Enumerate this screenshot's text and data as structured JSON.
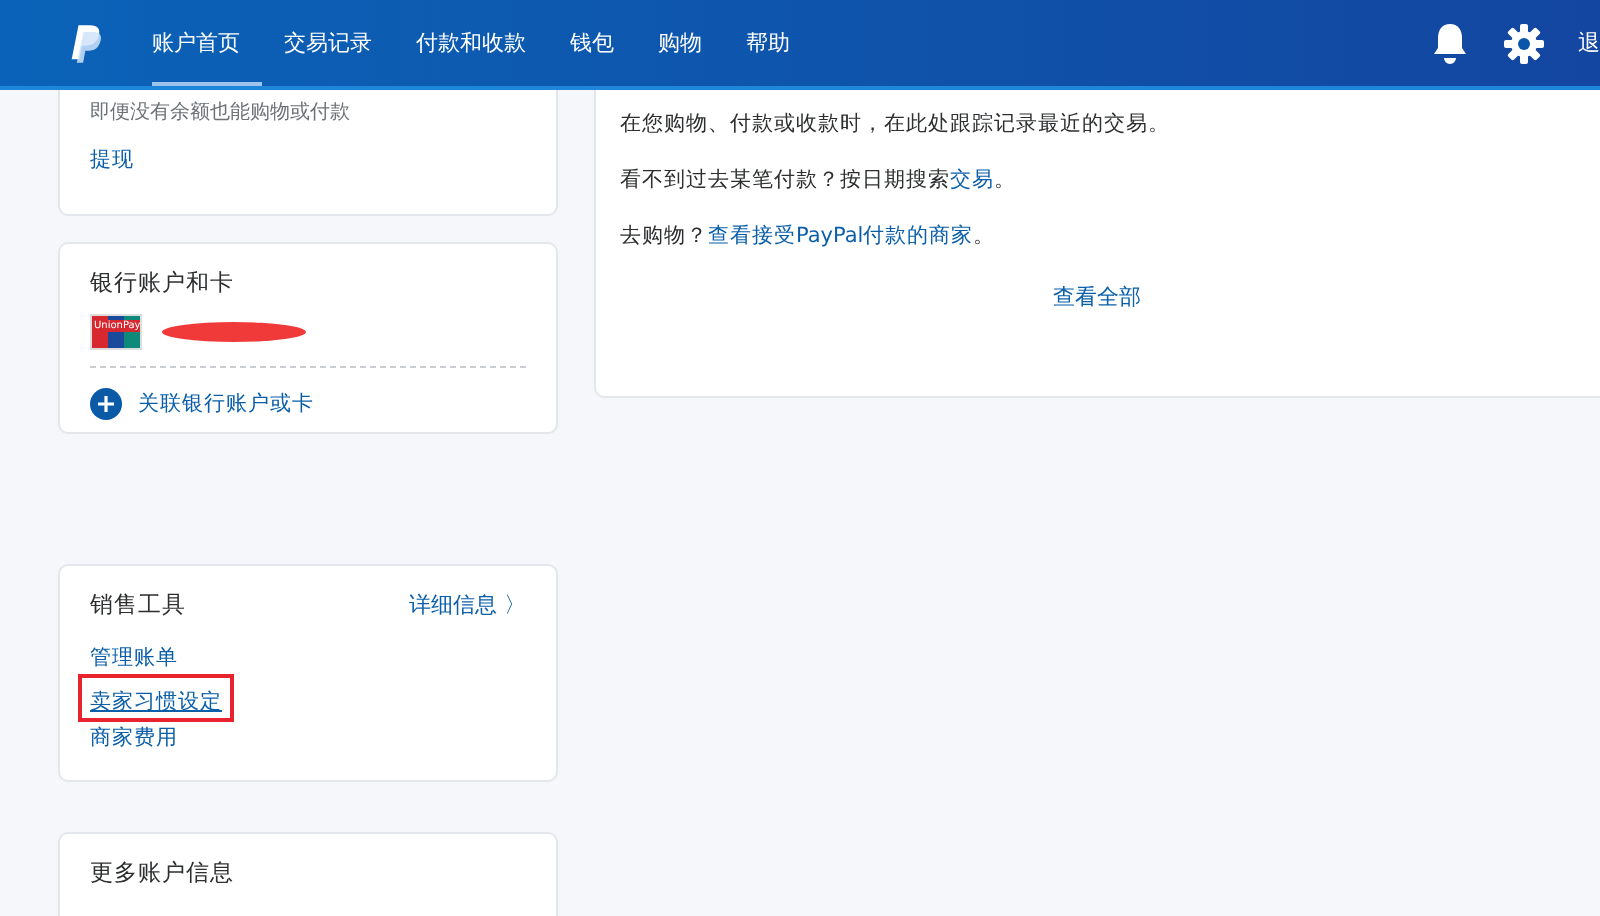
{
  "header": {
    "nav": [
      {
        "label": "账户首页",
        "selected": true
      },
      {
        "label": "交易记录",
        "selected": false
      },
      {
        "label": "付款和收款",
        "selected": false
      },
      {
        "label": "钱包",
        "selected": false
      },
      {
        "label": "购物",
        "selected": false
      },
      {
        "label": "帮助",
        "selected": false
      }
    ],
    "logout_partial": "退"
  },
  "balance_card": {
    "note": "即便没有余额也能购物或付款",
    "link": "提现"
  },
  "bank_card": {
    "title": "银行账户和卡",
    "card_logo_text": "UnionPay",
    "link_card": "关联银行账户或卡"
  },
  "sales_tools": {
    "title": "销售工具",
    "details": "详细信息 〉",
    "links": [
      {
        "label": "管理账单",
        "highlighted": false
      },
      {
        "label": "卖家习惯设定",
        "highlighted": true
      },
      {
        "label": "商家费用",
        "highlighted": false
      }
    ]
  },
  "more_info": {
    "title": "更多账户信息"
  },
  "activity": {
    "lines": [
      {
        "text": "在您购物、付款或收款时，在此处跟踪记录最近的交易。"
      },
      {
        "text": "看不到过去某笔付款？按日期搜索",
        "link": "交易",
        "after": "。"
      },
      {
        "text": "去购物？",
        "link": "查看接受PayPal付款的商家",
        "after": "。"
      }
    ],
    "view_all": "查看全部"
  }
}
